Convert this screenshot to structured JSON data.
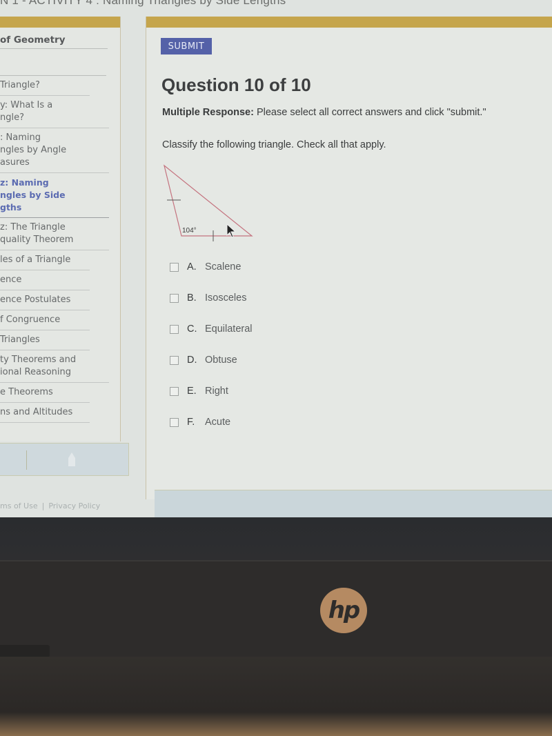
{
  "browser": {
    "page_title": "N 1 - ACTIVITY 4 : Naming Triangles by Side Lengths"
  },
  "sidebar": {
    "header": "of Geometry",
    "items": [
      {
        "label": "Triangle?",
        "lines": [
          "Triangle?"
        ],
        "active": false
      },
      {
        "label": "y: What Is a ngle?",
        "lines": [
          "y: What Is a",
          "ngle?"
        ],
        "active": false
      },
      {
        "label": ": Naming ngles by Angle asures",
        "lines": [
          ": Naming",
          "ngles by Angle",
          "asures"
        ],
        "active": false
      },
      {
        "label": "z: Naming ngles by Side gths",
        "lines": [
          "z: Naming",
          "ngles by Side",
          "gths"
        ],
        "active": true
      },
      {
        "label": "z: The Triangle quality Theorem",
        "lines": [
          "z: The Triangle",
          "quality Theorem"
        ],
        "active": false
      },
      {
        "label": "les of a Triangle",
        "lines": [
          "les of a Triangle"
        ],
        "active": false
      },
      {
        "label": "ence",
        "lines": [
          "ence"
        ],
        "active": false
      },
      {
        "label": "ence Postulates",
        "lines": [
          "ence Postulates"
        ],
        "active": false
      },
      {
        "label": "f Congruence",
        "lines": [
          "f Congruence"
        ],
        "active": false
      },
      {
        "label": "Triangles",
        "lines": [
          "Triangles"
        ],
        "active": false
      },
      {
        "label": "ty Theorems and ional Reasoning",
        "lines": [
          "ty Theorems and",
          "ional Reasoning"
        ],
        "active": false
      },
      {
        "label": "e Theorems",
        "lines": [
          "e Theorems"
        ],
        "active": false
      },
      {
        "label": "ns and Altitudes",
        "lines": [
          "ns and Altitudes"
        ],
        "active": false
      }
    ],
    "footer": {
      "terms_label": "ms of Use",
      "separator": "|",
      "privacy_label": "Privacy Policy"
    }
  },
  "question": {
    "submit_label": "SUBMIT",
    "title": "Question 10 of 10",
    "type_label": "Multiple Response:",
    "instructions": " Please select all correct answers and click \"submit.\"",
    "prompt": "Classify the following triangle. Check all that apply.",
    "figure": {
      "shape": "triangle",
      "angle_label": "104°",
      "tick_marks": "one tick on left side, one tick on bottom side",
      "stroke_color": "#c4727e"
    },
    "options": [
      {
        "letter": "A.",
        "text": "Scalene",
        "checked": false
      },
      {
        "letter": "B.",
        "text": "Isosceles",
        "checked": false
      },
      {
        "letter": "C.",
        "text": "Equilateral",
        "checked": false
      },
      {
        "letter": "D.",
        "text": "Obtuse",
        "checked": false
      },
      {
        "letter": "E.",
        "text": "Right",
        "checked": false
      },
      {
        "letter": "F.",
        "text": "Acute",
        "checked": false
      }
    ]
  },
  "colors": {
    "accent_gold": "#c5a54c",
    "submit_blue": "#5461a8",
    "active_nav_blue": "#5b6bb1"
  },
  "device": {
    "logo": "hp"
  }
}
